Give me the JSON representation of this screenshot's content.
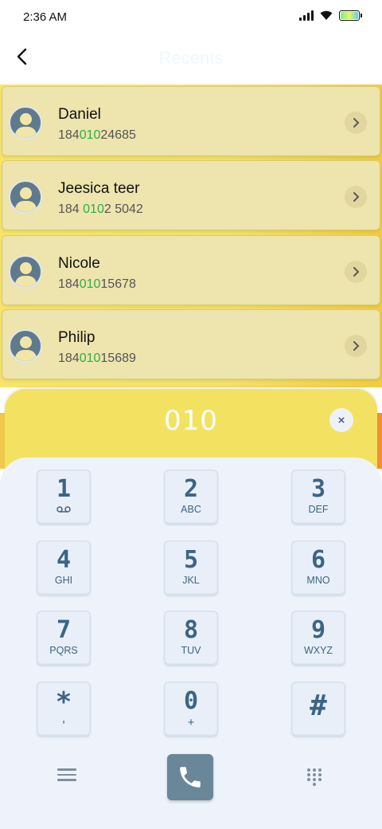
{
  "status": {
    "time": "2:36 AM"
  },
  "header": {
    "title": "Recents"
  },
  "contacts": [
    {
      "name": "Daniel",
      "phone_pre": "184",
      "phone_match": "010",
      "phone_post": "24685"
    },
    {
      "name": "Jeesica teer",
      "phone_pre": "184 ",
      "phone_match": "010",
      "phone_post": "2 5042"
    },
    {
      "name": "Nicole",
      "phone_pre": "184",
      "phone_match": "010",
      "phone_post": "15678"
    },
    {
      "name": "Philip",
      "phone_pre": "184",
      "phone_match": "010",
      "phone_post": "15689"
    }
  ],
  "dialer": {
    "number": "010",
    "clear_label": "×",
    "keys": [
      {
        "digit": "1",
        "letters": ""
      },
      {
        "digit": "2",
        "letters": "ABC"
      },
      {
        "digit": "3",
        "letters": "DEF"
      },
      {
        "digit": "4",
        "letters": "GHI"
      },
      {
        "digit": "5",
        "letters": "JKL"
      },
      {
        "digit": "6",
        "letters": "MNO"
      },
      {
        "digit": "7",
        "letters": "PQRS"
      },
      {
        "digit": "8",
        "letters": "TUV"
      },
      {
        "digit": "9",
        "letters": "WXYZ"
      },
      {
        "digit": "*",
        "letters": ","
      },
      {
        "digit": "0",
        "letters": "+"
      },
      {
        "digit": "#",
        "letters": ""
      }
    ]
  },
  "colors": {
    "match_highlight": "#2fae4a",
    "accent": "#6a8799",
    "card": "#ede4ae"
  },
  "icons": {
    "back": "chevron-left-icon",
    "row_action": "chevron-right-icon",
    "voicemail": "voicemail-icon",
    "call": "phone-icon",
    "menu": "menu-icon",
    "keypad": "dialpad-icon"
  }
}
